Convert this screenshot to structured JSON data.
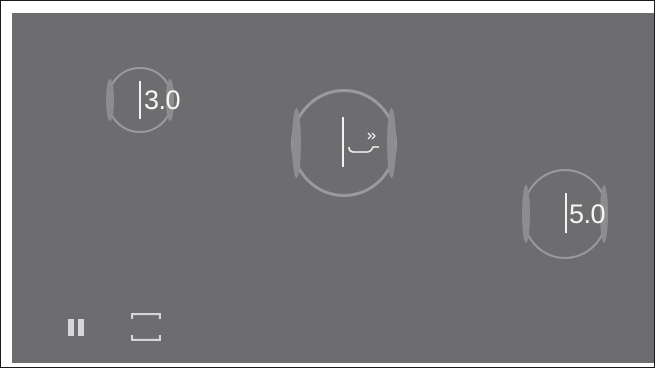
{
  "zones": [
    {
      "name": "zone-left",
      "value": "3.0"
    },
    {
      "name": "zone-center",
      "icon": "pan-boost-icon"
    },
    {
      "name": "zone-right",
      "value": "5.0"
    }
  ],
  "controls": {
    "pause_icon": "pause-icon",
    "fullscreen_icon": "fullscreen-icon"
  },
  "colors": {
    "panel_bg": "#6d6d6f",
    "zone_outline": "#9b9b9d",
    "text": "#f5f5f5"
  }
}
